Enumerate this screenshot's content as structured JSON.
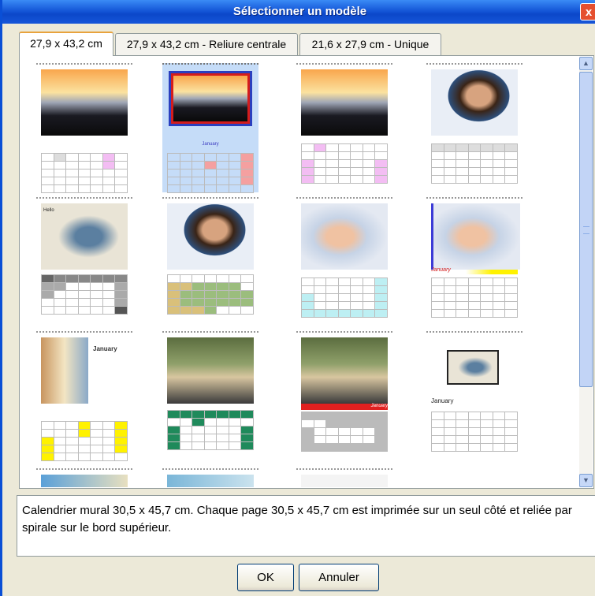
{
  "window": {
    "title": "Sélectionner un modèle",
    "close_label": "x"
  },
  "tabs": [
    {
      "label": "27,9 x 43,2 cm",
      "active": true
    },
    {
      "label": "27,9 x 43,2 cm - Reliure centrale",
      "active": false
    },
    {
      "label": "21,6 x 27,9 cm - Unique",
      "active": false
    }
  ],
  "templates": [
    {
      "image": "sunset-silhouette",
      "selected": false
    },
    {
      "image": "sunset-silhouette-framed",
      "selected": true,
      "caption": "January"
    },
    {
      "image": "sunset-silhouette",
      "selected": false
    },
    {
      "image": "woman-with-flowers",
      "selected": false
    },
    {
      "image": "man-in-cap",
      "selected": false,
      "caption": "Hello"
    },
    {
      "image": "woman-with-flowers",
      "selected": false
    },
    {
      "image": "baby",
      "selected": false
    },
    {
      "image": "baby",
      "selected": false,
      "caption": "January"
    },
    {
      "image": "kids-collage",
      "selected": false,
      "caption": "January"
    },
    {
      "image": "family-picnic",
      "selected": false
    },
    {
      "image": "family-picnic",
      "selected": false,
      "caption": "January"
    },
    {
      "image": "cowboy-small",
      "selected": false,
      "caption": "January"
    }
  ],
  "description": "Calendrier mural 30,5 x 45,7 cm. Chaque page 30,5 x 45,7 cm est imprimée sur un seul côté et reliée par spirale sur le bord supérieur.",
  "buttons": {
    "ok": "OK",
    "cancel": "Annuler"
  },
  "colors": {
    "title_bar": "#0b47c9",
    "active_tab_accent": "#e8a33d",
    "selection": "#c5dcf8"
  }
}
